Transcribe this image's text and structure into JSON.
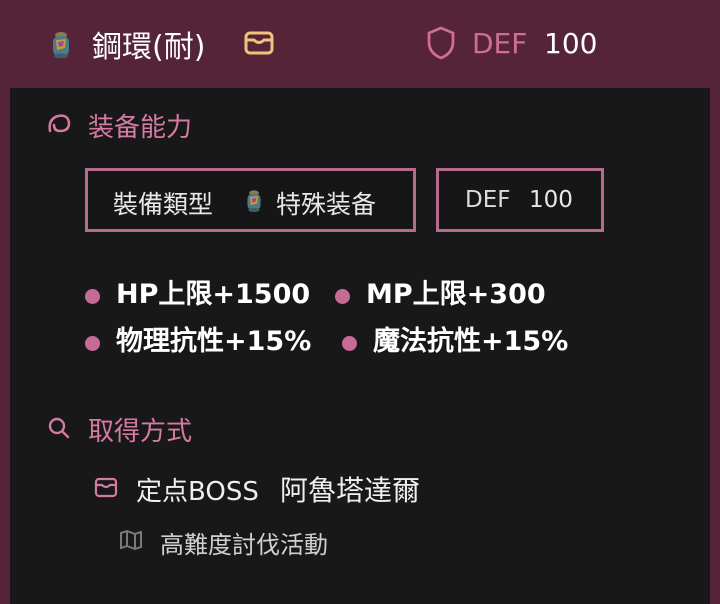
{
  "header": {
    "item_name": "鋼環(耐)",
    "def_label": "DEF",
    "def_value": "100"
  },
  "ability": {
    "section_title": "装备能力",
    "type_label": "裝備類型",
    "type_value": "特殊装备",
    "def_label": "DEF",
    "def_value": "100",
    "stats": [
      "HP上限+1500",
      "MP上限+300",
      "物理抗性+15%",
      "魔法抗性+15%"
    ]
  },
  "acquire": {
    "section_title": "取得方式",
    "source": "定点BOSS",
    "boss_name": "阿魯塔達爾",
    "sub_source": "高難度討伐活動"
  },
  "colors": {
    "accent": "#d57aa2",
    "header_bg": "#552438",
    "box_border": "#b56c8e"
  }
}
